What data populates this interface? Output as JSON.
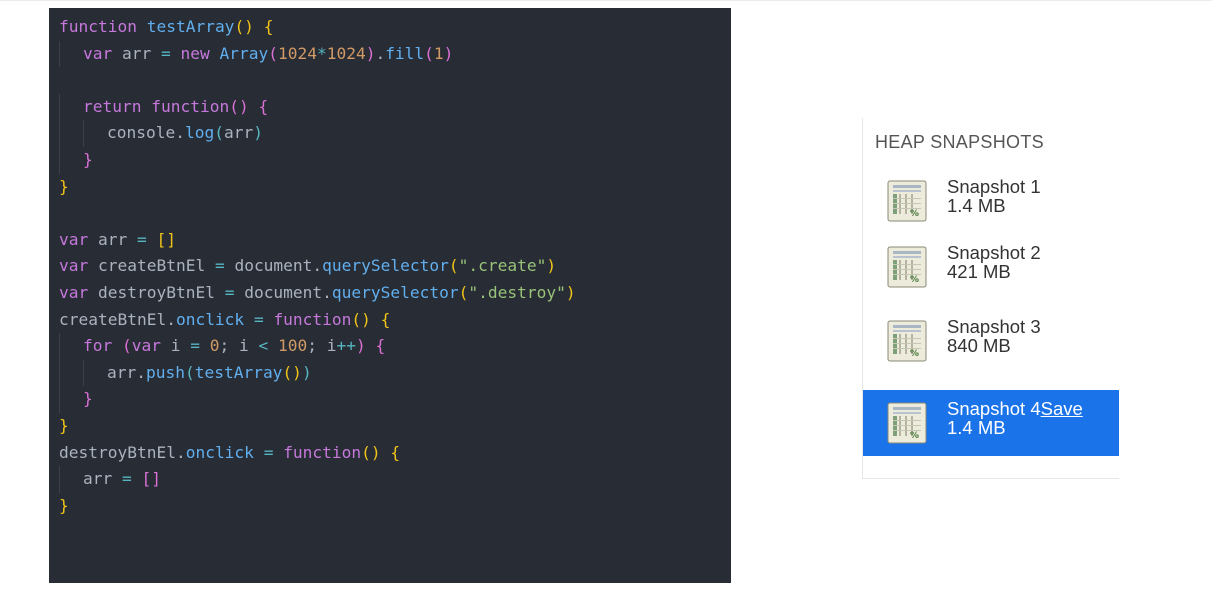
{
  "code": {
    "lines": [
      [
        {
          "t": "function",
          "c": "kw"
        },
        {
          "t": " "
        },
        {
          "t": "testArray",
          "c": "fn"
        },
        {
          "t": "()",
          "c": "br1"
        },
        {
          "t": " "
        },
        {
          "t": "{",
          "c": "br1"
        }
      ],
      [
        {
          "ind": 1
        },
        {
          "t": "var",
          "c": "kw"
        },
        {
          "t": " arr "
        },
        {
          "t": "=",
          "c": "op"
        },
        {
          "t": " "
        },
        {
          "t": "new",
          "c": "kw"
        },
        {
          "t": " "
        },
        {
          "t": "Array",
          "c": "fn"
        },
        {
          "t": "(",
          "c": "br2"
        },
        {
          "t": "1024",
          "c": "num"
        },
        {
          "t": "*",
          "c": "op"
        },
        {
          "t": "1024",
          "c": "num"
        },
        {
          "t": ")",
          "c": "br2"
        },
        {
          "t": "."
        },
        {
          "t": "fill",
          "c": "fn"
        },
        {
          "t": "(",
          "c": "br2"
        },
        {
          "t": "1",
          "c": "num"
        },
        {
          "t": ")",
          "c": "br2"
        }
      ],
      [],
      [
        {
          "ind": 1
        },
        {
          "t": "return",
          "c": "kw"
        },
        {
          "t": " "
        },
        {
          "t": "function",
          "c": "kw"
        },
        {
          "t": "()",
          "c": "br2"
        },
        {
          "t": " "
        },
        {
          "t": "{",
          "c": "br2"
        }
      ],
      [
        {
          "ind": 2
        },
        {
          "t": "console."
        },
        {
          "t": "log",
          "c": "fn"
        },
        {
          "t": "(",
          "c": "br3"
        },
        {
          "t": "arr"
        },
        {
          "t": ")",
          "c": "br3"
        }
      ],
      [
        {
          "ind": 1
        },
        {
          "t": "}",
          "c": "br2"
        }
      ],
      [
        {
          "t": "}",
          "c": "br1"
        }
      ],
      [],
      [
        {
          "t": "var",
          "c": "kw"
        },
        {
          "t": " arr "
        },
        {
          "t": "=",
          "c": "op"
        },
        {
          "t": " "
        },
        {
          "t": "[]",
          "c": "br1"
        }
      ],
      [
        {
          "t": "var",
          "c": "kw"
        },
        {
          "t": " createBtnEl "
        },
        {
          "t": "=",
          "c": "op"
        },
        {
          "t": " document."
        },
        {
          "t": "querySelector",
          "c": "fn"
        },
        {
          "t": "(",
          "c": "br1"
        },
        {
          "t": "\".create\"",
          "c": "str"
        },
        {
          "t": ")",
          "c": "br1"
        }
      ],
      [
        {
          "t": "var",
          "c": "kw"
        },
        {
          "t": " destroyBtnEl "
        },
        {
          "t": "=",
          "c": "op"
        },
        {
          "t": " document."
        },
        {
          "t": "querySelector",
          "c": "fn"
        },
        {
          "t": "(",
          "c": "br1"
        },
        {
          "t": "\".destroy\"",
          "c": "str"
        },
        {
          "t": ")",
          "c": "br1"
        }
      ],
      [
        {
          "t": "createBtnEl."
        },
        {
          "t": "onclick",
          "c": "fn"
        },
        {
          "t": " "
        },
        {
          "t": "=",
          "c": "op"
        },
        {
          "t": " "
        },
        {
          "t": "function",
          "c": "kw"
        },
        {
          "t": "()",
          "c": "br1"
        },
        {
          "t": " "
        },
        {
          "t": "{",
          "c": "br1"
        }
      ],
      [
        {
          "ind": 1
        },
        {
          "t": "for",
          "c": "kw"
        },
        {
          "t": " "
        },
        {
          "t": "(",
          "c": "br2"
        },
        {
          "t": "var",
          "c": "kw"
        },
        {
          "t": " i "
        },
        {
          "t": "=",
          "c": "op"
        },
        {
          "t": " "
        },
        {
          "t": "0",
          "c": "num"
        },
        {
          "t": "; i "
        },
        {
          "t": "<",
          "c": "op"
        },
        {
          "t": " "
        },
        {
          "t": "100",
          "c": "num"
        },
        {
          "t": "; i"
        },
        {
          "t": "++",
          "c": "op"
        },
        {
          "t": ")",
          "c": "br2"
        },
        {
          "t": " "
        },
        {
          "t": "{",
          "c": "br2"
        }
      ],
      [
        {
          "ind": 2
        },
        {
          "t": "arr."
        },
        {
          "t": "push",
          "c": "fn"
        },
        {
          "t": "(",
          "c": "br3"
        },
        {
          "t": "testArray",
          "c": "fn"
        },
        {
          "t": "()",
          "c": "br1"
        },
        {
          "t": ")",
          "c": "br3"
        }
      ],
      [
        {
          "ind": 1
        },
        {
          "t": "}",
          "c": "br2"
        }
      ],
      [
        {
          "t": "}",
          "c": "br1"
        }
      ],
      [
        {
          "t": "destroyBtnEl."
        },
        {
          "t": "onclick",
          "c": "fn"
        },
        {
          "t": " "
        },
        {
          "t": "=",
          "c": "op"
        },
        {
          "t": " "
        },
        {
          "t": "function",
          "c": "kw"
        },
        {
          "t": "()",
          "c": "br1"
        },
        {
          "t": " "
        },
        {
          "t": "{",
          "c": "br1"
        }
      ],
      [
        {
          "ind": 1
        },
        {
          "t": "arr "
        },
        {
          "t": "=",
          "c": "op"
        },
        {
          "t": " "
        },
        {
          "t": "[]",
          "c": "br2"
        }
      ],
      [
        {
          "t": "}",
          "c": "br1"
        }
      ]
    ]
  },
  "heap": {
    "header": "HEAP SNAPSHOTS",
    "snapshots": [
      {
        "name": "Snapshot 1",
        "size": "1.4 MB",
        "selected": false
      },
      {
        "name": "Snapshot 2",
        "size": "421 MB",
        "selected": false
      },
      {
        "name": "Snapshot 3",
        "size": "840 MB",
        "selected": false
      },
      {
        "name": "Snapshot 4",
        "size": "1.4 MB",
        "selected": true,
        "action": "Save"
      }
    ],
    "icon": "snapshot-file-icon"
  }
}
